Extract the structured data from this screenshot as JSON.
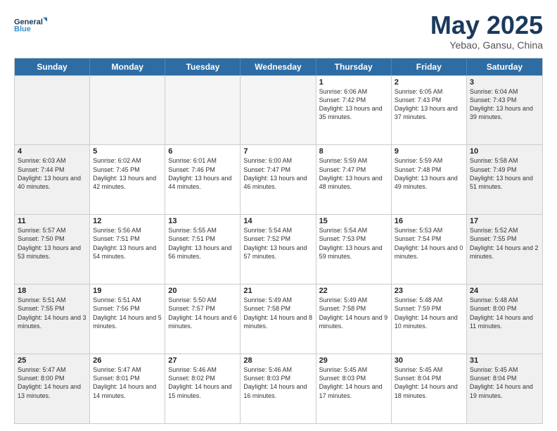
{
  "logo": {
    "line1": "General",
    "line2": "Blue"
  },
  "title": "May 2025",
  "subtitle": "Yebao, Gansu, China",
  "days": [
    "Sunday",
    "Monday",
    "Tuesday",
    "Wednesday",
    "Thursday",
    "Friday",
    "Saturday"
  ],
  "weeks": [
    [
      {
        "day": "",
        "content": ""
      },
      {
        "day": "",
        "content": ""
      },
      {
        "day": "",
        "content": ""
      },
      {
        "day": "",
        "content": ""
      },
      {
        "day": "1",
        "content": "Sunrise: 6:06 AM\nSunset: 7:42 PM\nDaylight: 13 hours\nand 35 minutes."
      },
      {
        "day": "2",
        "content": "Sunrise: 6:05 AM\nSunset: 7:43 PM\nDaylight: 13 hours\nand 37 minutes."
      },
      {
        "day": "3",
        "content": "Sunrise: 6:04 AM\nSunset: 7:43 PM\nDaylight: 13 hours\nand 39 minutes."
      }
    ],
    [
      {
        "day": "4",
        "content": "Sunrise: 6:03 AM\nSunset: 7:44 PM\nDaylight: 13 hours\nand 40 minutes."
      },
      {
        "day": "5",
        "content": "Sunrise: 6:02 AM\nSunset: 7:45 PM\nDaylight: 13 hours\nand 42 minutes."
      },
      {
        "day": "6",
        "content": "Sunrise: 6:01 AM\nSunset: 7:46 PM\nDaylight: 13 hours\nand 44 minutes."
      },
      {
        "day": "7",
        "content": "Sunrise: 6:00 AM\nSunset: 7:47 PM\nDaylight: 13 hours\nand 46 minutes."
      },
      {
        "day": "8",
        "content": "Sunrise: 5:59 AM\nSunset: 7:47 PM\nDaylight: 13 hours\nand 48 minutes."
      },
      {
        "day": "9",
        "content": "Sunrise: 5:59 AM\nSunset: 7:48 PM\nDaylight: 13 hours\nand 49 minutes."
      },
      {
        "day": "10",
        "content": "Sunrise: 5:58 AM\nSunset: 7:49 PM\nDaylight: 13 hours\nand 51 minutes."
      }
    ],
    [
      {
        "day": "11",
        "content": "Sunrise: 5:57 AM\nSunset: 7:50 PM\nDaylight: 13 hours\nand 53 minutes."
      },
      {
        "day": "12",
        "content": "Sunrise: 5:56 AM\nSunset: 7:51 PM\nDaylight: 13 hours\nand 54 minutes."
      },
      {
        "day": "13",
        "content": "Sunrise: 5:55 AM\nSunset: 7:51 PM\nDaylight: 13 hours\nand 56 minutes."
      },
      {
        "day": "14",
        "content": "Sunrise: 5:54 AM\nSunset: 7:52 PM\nDaylight: 13 hours\nand 57 minutes."
      },
      {
        "day": "15",
        "content": "Sunrise: 5:54 AM\nSunset: 7:53 PM\nDaylight: 13 hours\nand 59 minutes."
      },
      {
        "day": "16",
        "content": "Sunrise: 5:53 AM\nSunset: 7:54 PM\nDaylight: 14 hours\nand 0 minutes."
      },
      {
        "day": "17",
        "content": "Sunrise: 5:52 AM\nSunset: 7:55 PM\nDaylight: 14 hours\nand 2 minutes."
      }
    ],
    [
      {
        "day": "18",
        "content": "Sunrise: 5:51 AM\nSunset: 7:55 PM\nDaylight: 14 hours\nand 3 minutes."
      },
      {
        "day": "19",
        "content": "Sunrise: 5:51 AM\nSunset: 7:56 PM\nDaylight: 14 hours\nand 5 minutes."
      },
      {
        "day": "20",
        "content": "Sunrise: 5:50 AM\nSunset: 7:57 PM\nDaylight: 14 hours\nand 6 minutes."
      },
      {
        "day": "21",
        "content": "Sunrise: 5:49 AM\nSunset: 7:58 PM\nDaylight: 14 hours\nand 8 minutes."
      },
      {
        "day": "22",
        "content": "Sunrise: 5:49 AM\nSunset: 7:58 PM\nDaylight: 14 hours\nand 9 minutes."
      },
      {
        "day": "23",
        "content": "Sunrise: 5:48 AM\nSunset: 7:59 PM\nDaylight: 14 hours\nand 10 minutes."
      },
      {
        "day": "24",
        "content": "Sunrise: 5:48 AM\nSunset: 8:00 PM\nDaylight: 14 hours\nand 11 minutes."
      }
    ],
    [
      {
        "day": "25",
        "content": "Sunrise: 5:47 AM\nSunset: 8:00 PM\nDaylight: 14 hours\nand 13 minutes."
      },
      {
        "day": "26",
        "content": "Sunrise: 5:47 AM\nSunset: 8:01 PM\nDaylight: 14 hours\nand 14 minutes."
      },
      {
        "day": "27",
        "content": "Sunrise: 5:46 AM\nSunset: 8:02 PM\nDaylight: 14 hours\nand 15 minutes."
      },
      {
        "day": "28",
        "content": "Sunrise: 5:46 AM\nSunset: 8:03 PM\nDaylight: 14 hours\nand 16 minutes."
      },
      {
        "day": "29",
        "content": "Sunrise: 5:45 AM\nSunset: 8:03 PM\nDaylight: 14 hours\nand 17 minutes."
      },
      {
        "day": "30",
        "content": "Sunrise: 5:45 AM\nSunset: 8:04 PM\nDaylight: 14 hours\nand 18 minutes."
      },
      {
        "day": "31",
        "content": "Sunrise: 5:45 AM\nSunset: 8:04 PM\nDaylight: 14 hours\nand 19 minutes."
      }
    ]
  ]
}
